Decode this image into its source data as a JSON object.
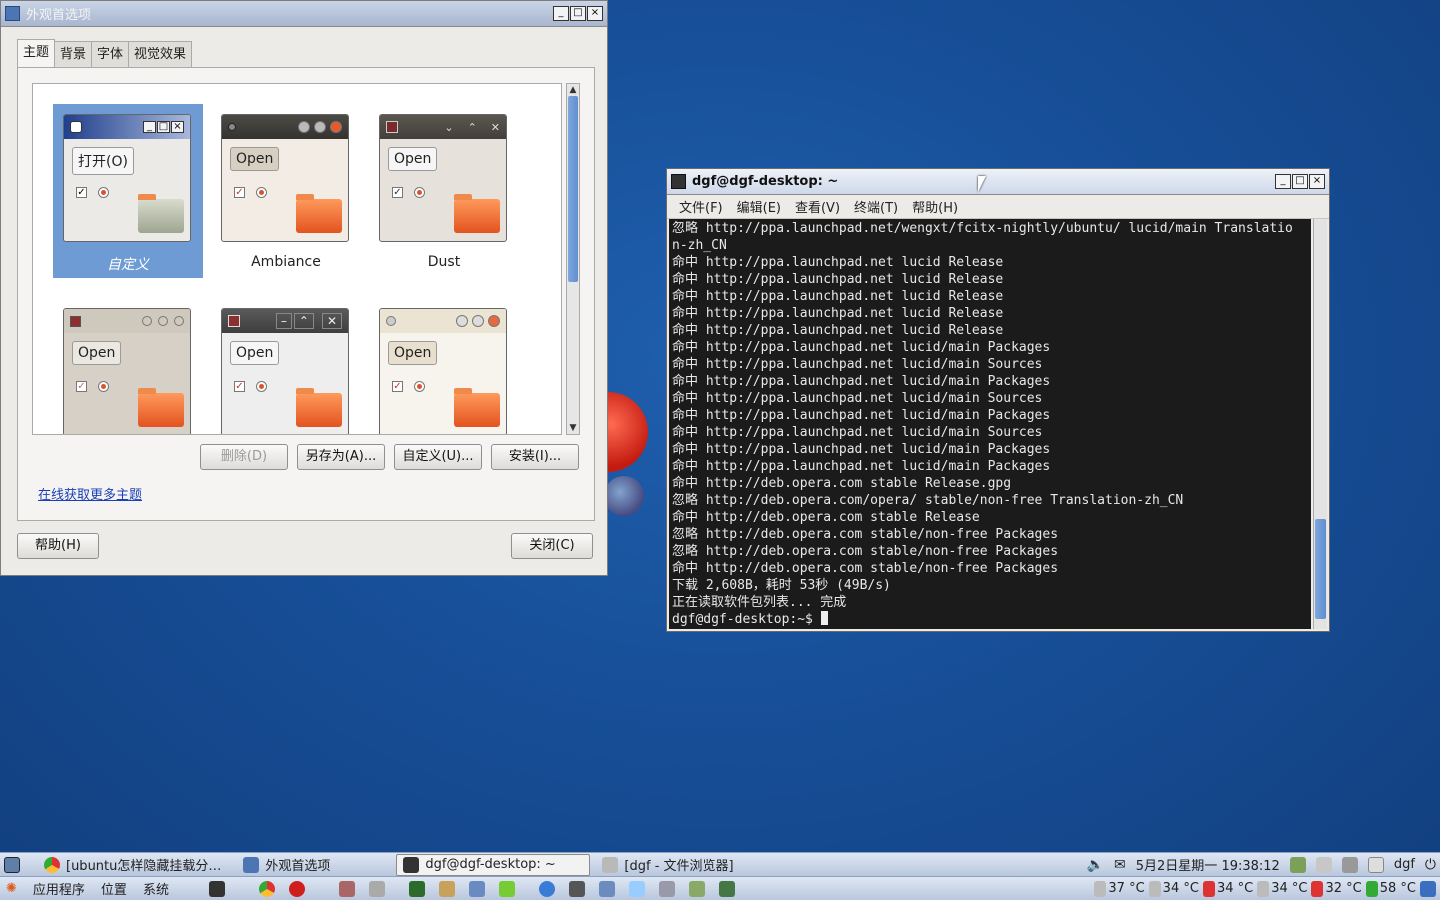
{
  "appearance": {
    "title": "外观首选项",
    "tabs": [
      "主题",
      "背景",
      "字体",
      "视觉效果"
    ],
    "themes": [
      {
        "label": "自定义",
        "button": "打开(O)"
      },
      {
        "label": "Ambiance",
        "button": "Open"
      },
      {
        "label": "Dust",
        "button": "Open"
      },
      {
        "label": "",
        "button": "Open"
      },
      {
        "label": "",
        "button": "Open"
      },
      {
        "label": "",
        "button": "Open"
      }
    ],
    "buttons": {
      "delete": "删除(D)",
      "save_as": "另存为(A)...",
      "customize": "自定义(U)...",
      "install": "安装(I)..."
    },
    "more_link": "在线获取更多主题",
    "help": "帮助(H)",
    "close": "关闭(C)"
  },
  "terminal": {
    "title": "dgf@dgf-desktop: ~",
    "menu": [
      "文件(F)",
      "编辑(E)",
      "查看(V)",
      "终端(T)",
      "帮助(H)"
    ],
    "lines": [
      "忽略 http://ppa.launchpad.net/wengxt/fcitx-nightly/ubuntu/ lucid/main Translatio",
      "n-zh_CN",
      "命中 http://ppa.launchpad.net lucid Release",
      "命中 http://ppa.launchpad.net lucid Release",
      "命中 http://ppa.launchpad.net lucid Release",
      "命中 http://ppa.launchpad.net lucid Release",
      "命中 http://ppa.launchpad.net lucid Release",
      "命中 http://ppa.launchpad.net lucid/main Packages",
      "命中 http://ppa.launchpad.net lucid/main Sources",
      "命中 http://ppa.launchpad.net lucid/main Packages",
      "命中 http://ppa.launchpad.net lucid/main Sources",
      "命中 http://ppa.launchpad.net lucid/main Packages",
      "命中 http://ppa.launchpad.net lucid/main Sources",
      "命中 http://ppa.launchpad.net lucid/main Packages",
      "命中 http://ppa.launchpad.net lucid/main Packages",
      "命中 http://deb.opera.com stable Release.gpg",
      "忽略 http://deb.opera.com/opera/ stable/non-free Translation-zh_CN",
      "命中 http://deb.opera.com stable Release",
      "忽略 http://deb.opera.com stable/non-free Packages",
      "忽略 http://deb.opera.com stable/non-free Packages",
      "命中 http://deb.opera.com stable/non-free Packages",
      "下载 2,608B，耗时 53秒 (49B/s)",
      "正在读取软件包列表... 完成"
    ],
    "prompt": "dgf@dgf-desktop:~$ "
  },
  "taskbar": {
    "tasks": [
      "[ubuntu怎样隐藏挂载分…",
      "外观首选项",
      "dgf@dgf-desktop: ~",
      "[dgf - 文件浏览器]"
    ],
    "datetime": "5月2日星期一 19:38:12",
    "user": "dgf"
  },
  "bottom_panel": {
    "menus": [
      "应用程序",
      "位置",
      "系统"
    ],
    "temps": [
      "37 °C",
      "34 °C",
      "34 °C",
      "34 °C",
      "32 °C",
      "58 °C"
    ]
  }
}
